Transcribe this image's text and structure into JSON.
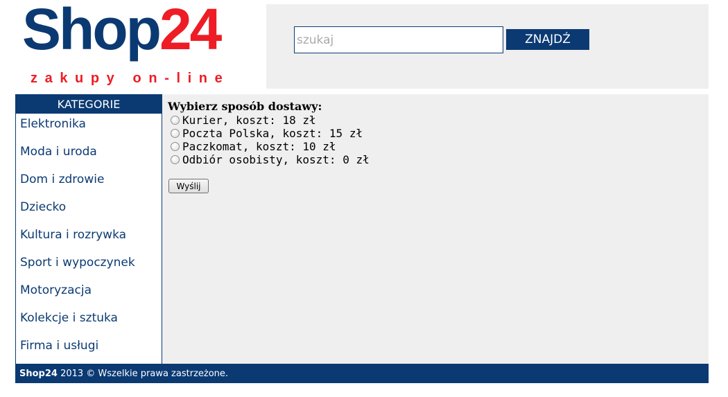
{
  "header": {
    "logo_shop": "Shop",
    "logo_number": "24",
    "tagline": "zakupy on-line",
    "search_placeholder": "szukaj",
    "search_button": "ZNAJDŹ"
  },
  "sidebar": {
    "title": "KATEGORIE",
    "items": [
      "Elektronika",
      "Moda i uroda",
      "Dom i zdrowie",
      "Dziecko",
      "Kultura i rozrywka",
      "Sport i wypoczynek",
      "Motoryzacja",
      "Kolekcje i sztuka",
      "Firma i usługi"
    ]
  },
  "delivery_form": {
    "title": "Wybierz sposób dostawy:",
    "options": [
      "Kurier, koszt: 18 zł",
      "Poczta Polska, koszt: 15 zł",
      "Paczkomat, koszt: 10 zł",
      "Odbiór osobisty, koszt: 0 zł"
    ],
    "submit": "Wyślij"
  },
  "footer": {
    "brand": "Shop24",
    "text": " 2013 © Wszelkie prawa zastrzeżone."
  },
  "colors": {
    "brand_navy": "#0b3a73",
    "brand_red": "#ee1c25",
    "panel_gray": "#efefef"
  }
}
